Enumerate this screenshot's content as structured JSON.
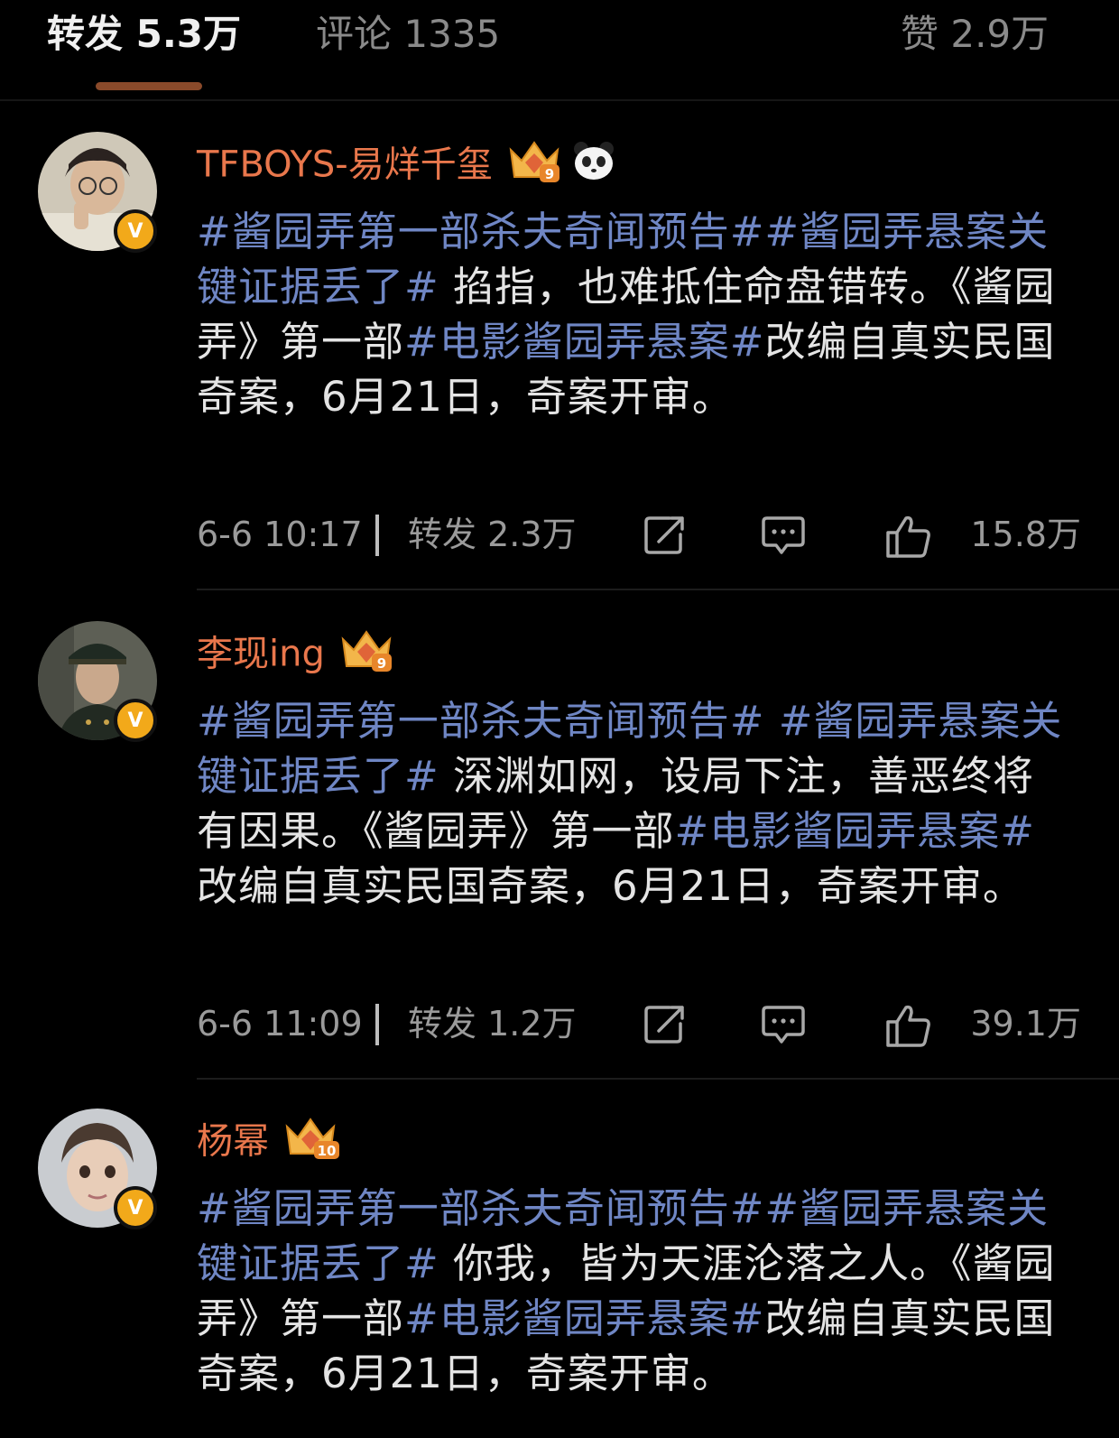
{
  "tabs": [
    {
      "label": "转发 5.3万"
    },
    {
      "label": "评论 1335"
    },
    {
      "label": "赞 2.9万"
    }
  ],
  "posts": [
    {
      "username": "TFBOYS-易烊千玺",
      "level": "9",
      "verified_mark": "V",
      "segments": [
        {
          "text": "#酱园弄第一部杀夫奇闻预告##酱园弄悬案关键证据丢了#",
          "tag": true
        },
        {
          "text": " 掐指，也难抵住命盘错转。《酱园弄》第一部",
          "tag": false
        },
        {
          "text": "#电影酱园弄悬案#",
          "tag": true
        },
        {
          "text": "改编自真实民国奇案，6月21日，奇案开审。",
          "tag": false
        }
      ],
      "time": "6-6 10:17",
      "repost": "转发 2.3万",
      "likes": "15.8万"
    },
    {
      "username": "李现ing",
      "level": "9",
      "verified_mark": "V",
      "segments": [
        {
          "text": "#酱园弄第一部杀夫奇闻预告# #酱园弄悬案关键证据丢了#",
          "tag": true
        },
        {
          "text": " 深渊如网，设局下注，善恶终将有因果。《酱园弄》第一部",
          "tag": false
        },
        {
          "text": "#电影酱园弄悬案#",
          "tag": true
        },
        {
          "text": " 改编自真实民国奇案，6月21日，奇案开审。",
          "tag": false
        }
      ],
      "time": "6-6 11:09",
      "repost": "转发 1.2万",
      "likes": "39.1万"
    },
    {
      "username": "杨幂",
      "level": "10",
      "verified_mark": "V",
      "segments": [
        {
          "text": "#酱园弄第一部杀夫奇闻预告##酱园弄悬案关键证据丢了#",
          "tag": true
        },
        {
          "text": " 你我，皆为天涯沦落之人。《酱园弄》第一部",
          "tag": false
        },
        {
          "text": "#电影酱园弄悬案#",
          "tag": true
        },
        {
          "text": "改编自真实民国奇案，6月21日，奇案开审。",
          "tag": false
        }
      ]
    }
  ],
  "colors": {
    "accent": "#e9774c",
    "tag": "#6f86c4",
    "background": "#000000",
    "tab_indicator": "#8a4a2a"
  },
  "icons": [
    "share-icon",
    "comment-icon",
    "like-icon",
    "crown-level-badge",
    "panda-icon",
    "verified-badge"
  ]
}
